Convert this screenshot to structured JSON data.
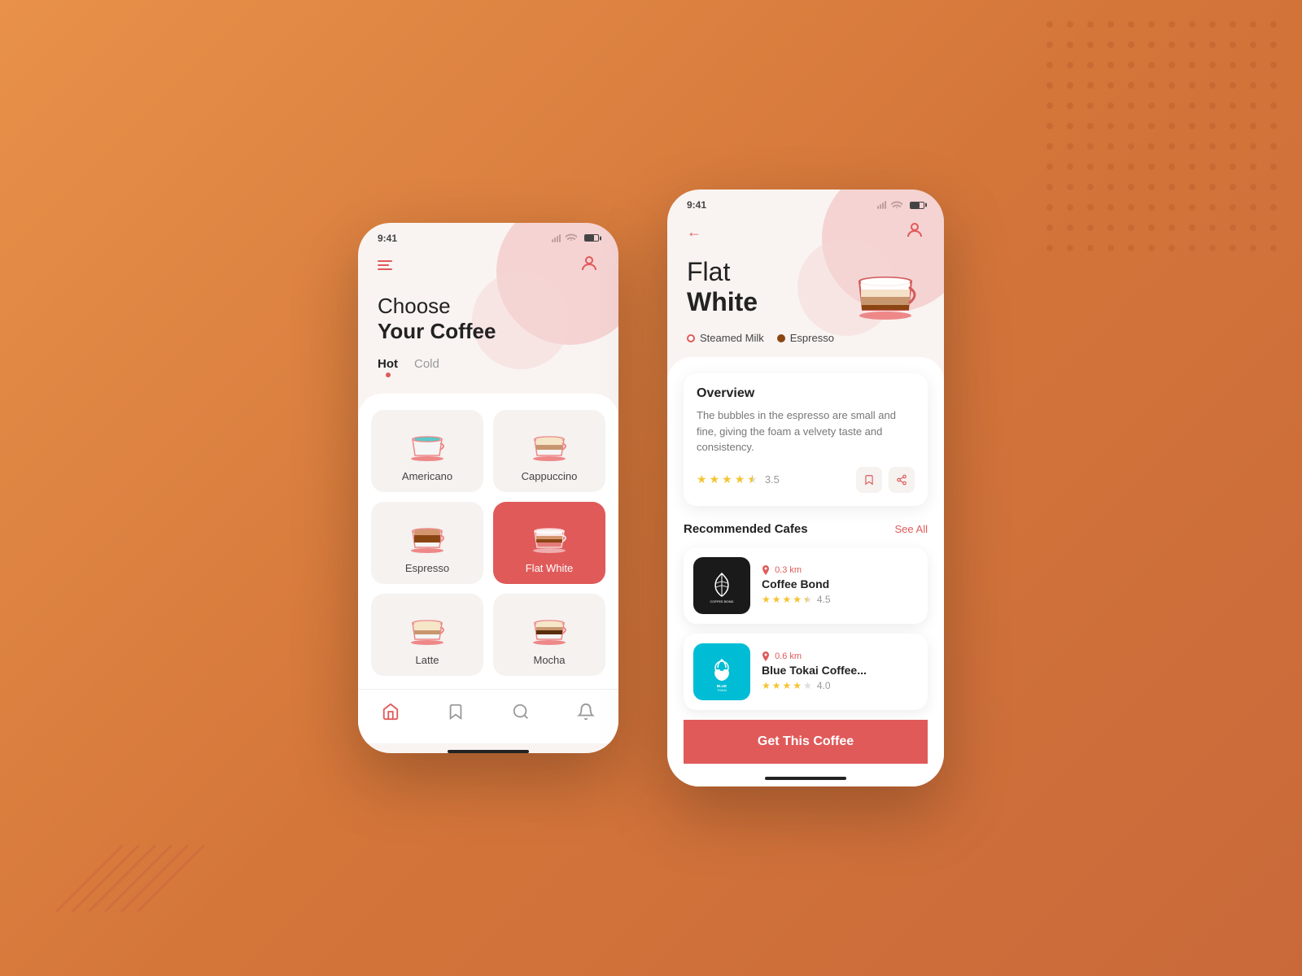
{
  "background": {
    "color": "#d4763a"
  },
  "phone1": {
    "status_time": "9:41",
    "title_line1": "Choose",
    "title_line2": "Your Coffee",
    "tabs": [
      {
        "label": "Hot",
        "active": true
      },
      {
        "label": "Cold",
        "active": false
      }
    ],
    "coffees": [
      {
        "name": "Americano",
        "type": "americano",
        "selected": false
      },
      {
        "name": "Cappuccino",
        "type": "cappuccino",
        "selected": false
      },
      {
        "name": "Espresso",
        "type": "espresso",
        "selected": false
      },
      {
        "name": "Flat White",
        "type": "flatwhite",
        "selected": true
      },
      {
        "name": "Latte",
        "type": "latte",
        "selected": false
      },
      {
        "name": "Mocha",
        "type": "mocha",
        "selected": false
      }
    ],
    "nav": {
      "items": [
        "home",
        "bookmark",
        "search",
        "bell"
      ]
    }
  },
  "phone2": {
    "status_time": "9:41",
    "coffee_name_line1": "Flat",
    "coffee_name_line2": "White",
    "ingredients": [
      {
        "name": "Steamed Milk",
        "dot": "milk"
      },
      {
        "name": "Espresso",
        "dot": "espresso"
      }
    ],
    "overview": {
      "title": "Overview",
      "text": "The bubbles in the espresso are small and fine, giving the foam a velvety taste and consistency.",
      "rating": "3.5"
    },
    "recommended_cafes_title": "Recommended Cafes",
    "see_all_label": "See All",
    "cafes": [
      {
        "name": "Coffee Bond",
        "distance": "0.3 km",
        "rating": "4.5",
        "logo_type": "dark"
      },
      {
        "name": "Blue Tokai Coffee...",
        "distance": "0.6 km",
        "rating": "4.0",
        "logo_type": "teal"
      }
    ],
    "cta_button": "Get This Coffee"
  }
}
